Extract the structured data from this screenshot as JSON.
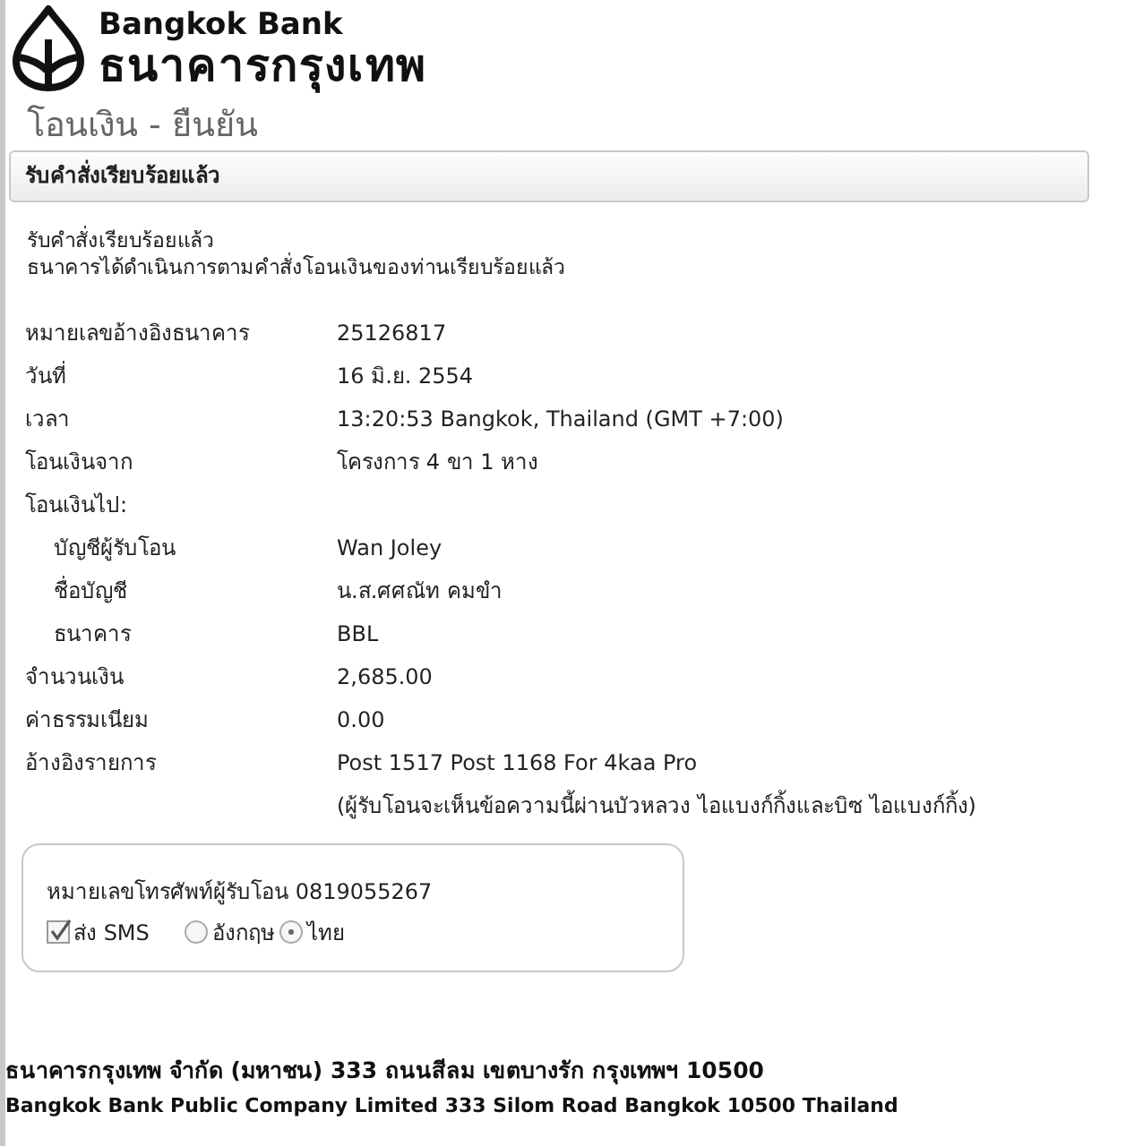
{
  "header": {
    "brand_en": "Bangkok Bank",
    "brand_th": "ธนาคารกรุงเทพ"
  },
  "page_title": "โอนเงิน - ยืนยัน",
  "panel_title": "รับคำสั่งเรียบร้อยแล้ว",
  "messages": [
    "รับคำสั่งเรียบร้อยแล้ว",
    "ธนาคารได้ดำเนินการตามคำสั่งโอนเงินของท่านเรียบร้อยแล้ว"
  ],
  "details": [
    {
      "kind": "row",
      "label": "หมายเลขอ้างอิงธนาคาร",
      "value": "25126817"
    },
    {
      "kind": "row",
      "label": "วันที่",
      "value": "16 มิ.ย. 2554"
    },
    {
      "kind": "row",
      "label": "เวลา",
      "value": "13:20:53 Bangkok, Thailand (GMT +7:00)"
    },
    {
      "kind": "row",
      "label": "โอนเงินจาก",
      "value": "โครงการ 4 ขา 1 หาง"
    },
    {
      "kind": "heading",
      "label": "โอนเงินไป:"
    },
    {
      "kind": "subrow",
      "label": "บัญชีผู้รับโอน",
      "value": "Wan Joley"
    },
    {
      "kind": "subrow",
      "label": "ชื่อบัญชี",
      "value": "น.ส.ศศณัท คมขำ"
    },
    {
      "kind": "subrow",
      "label": "ธนาคาร",
      "value": "BBL"
    },
    {
      "kind": "row",
      "label": "จำนวนเงิน",
      "value": "2,685.00"
    },
    {
      "kind": "row",
      "label": "ค่าธรรมเนียม",
      "value": "0.00"
    },
    {
      "kind": "row",
      "label": "อ้างอิงรายการ",
      "value": "Post 1517 Post 1168 For 4kaa Pro",
      "note": "(ผู้รับโอนจะเห็นข้อความนี้ผ่านบัวหลวง ไอแบงก์กิ้งและบิซ ไอแบงก์กิ้ง)"
    }
  ],
  "sms": {
    "phone": "หมายเลขโทรศัพท์ผู้รับโอน 0819055267",
    "send": {
      "label": "ส่ง SMS",
      "checked": true
    },
    "languages": [
      {
        "label": "อังกฤษ",
        "selected": false
      },
      {
        "label": "ไทย",
        "selected": true
      }
    ]
  },
  "footer": [
    "ธนาคารกรุงเทพ จำกัด (มหาชน)  333 ถนนสีลม เขตบางรัก กรุงเทพฯ 10500",
    "Bangkok Bank Public Company Limited 333 Silom Road Bangkok 10500 Thailand"
  ]
}
